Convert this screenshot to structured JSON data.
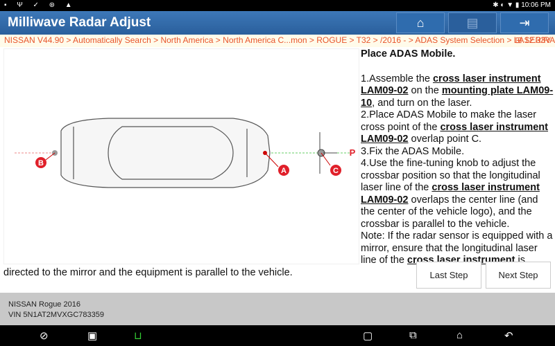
{
  "status_bar": {
    "left_icons": [
      "photo-icon",
      "usb-icon",
      "check-icon",
      "bluetooth-sync-icon",
      "warning-icon"
    ],
    "time": "10:06 PM"
  },
  "header": {
    "title": "Milliwave Radar Adjust",
    "buttons": [
      "home-icon",
      "print-icon",
      "exit-icon"
    ]
  },
  "breadcrumb": {
    "path": "NISSAN V44.90 > Automatically Search > North America > North America C...mon > ROGUE > T32 > /2016 - > ADAS System Selection > LASER/RADAR",
    "voltage": "12.33V"
  },
  "figure": {
    "labels": [
      "A",
      "B",
      "C",
      "P"
    ]
  },
  "instructions": {
    "title": "Place ADAS Mobile.",
    "p1": [
      "1.Assemble the ",
      "cross laser instrument LAM09-02",
      " on the ",
      "mounting plate LAM09-10",
      ", and turn on the laser."
    ],
    "p2": [
      "2.Place ADAS Mobile to make the laser cross point of the ",
      "cross laser instrument LAM09-02",
      " overlap point C."
    ],
    "p3": "3.Fix the ADAS Mobile.",
    "p4": [
      "4.Use the fine-tuning knob to adjust the crossbar position so that the longitudinal laser line of the ",
      "cross laser instrument LAM09-02",
      " overlaps the center line (and the center of the vehicle logo), and the crossbar is parallel to the vehicle."
    ],
    "note": [
      "Note: If the radar sensor is equipped with a mirror, ensure that the longitudinal laser line of the ",
      "cross laser instrument",
      " is"
    ],
    "tail": "directed to the mirror and the equipment is parallel to the vehicle."
  },
  "actions": {
    "last": "Last Step",
    "next": "Next Step"
  },
  "vehicle": {
    "model": "NISSAN Rogue 2016",
    "vin": "VIN 5N1AT2MVXGC783359"
  }
}
